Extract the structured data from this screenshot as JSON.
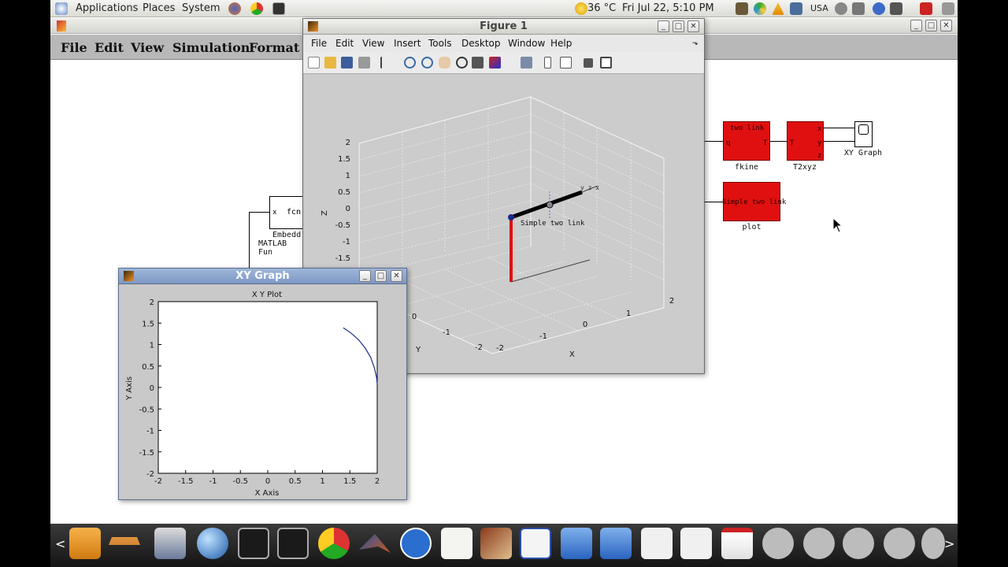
{
  "top_panel": {
    "menus": [
      "Applications",
      "Places",
      "System"
    ],
    "weather": "36 °C",
    "clock": "Fri Jul 22,  5:10 PM",
    "keyboard_layout": "USA"
  },
  "simulink": {
    "menus": [
      "File",
      "Edit",
      "View",
      "Simulation",
      "Format"
    ],
    "blocks": {
      "embedded_fcn": {
        "inner": "fcn",
        "port_in": "x",
        "label_line1": "Embedd",
        "label_line2": "MATLAB Fun"
      },
      "fkine": {
        "inner": "two link",
        "port_q": "q",
        "port_t": "T",
        "label": "fkine"
      },
      "t2xyz": {
        "port_t": "T",
        "port_x": "x",
        "port_y": "y",
        "port_z": "z",
        "label": "T2xyz"
      },
      "xy_graph": {
        "label": "XY Graph"
      },
      "plot": {
        "inner": "Simple two link",
        "label": "plot"
      }
    }
  },
  "figure1": {
    "title": "Figure 1",
    "menus": [
      "File",
      "Edit",
      "View",
      "Insert",
      "Tools",
      "Desktop",
      "Window",
      "Help"
    ],
    "menu_arrow": "⬎",
    "robot_label": "Simple two link",
    "arm_tip_labels": "y z x",
    "axis_labels": {
      "x": "X",
      "y": "Y",
      "z": "Z"
    },
    "z_ticks": [
      "2",
      "1.5",
      "1",
      "0.5",
      "0",
      "-0.5",
      "-1",
      "-1.5"
    ],
    "x_ticks": [
      "-2",
      "-1",
      "0",
      "1",
      "2"
    ],
    "y_ticks": [
      "-2",
      "-1",
      "0"
    ]
  },
  "xy_graph": {
    "title": "XY Graph",
    "chart_data": {
      "type": "line",
      "title": "X Y Plot",
      "xlabel": "X Axis",
      "ylabel": "Y Axis",
      "xlim": [
        -2,
        2
      ],
      "ylim": [
        -2,
        2
      ],
      "x_ticks": [
        "-2",
        "-1.5",
        "-1",
        "-0.5",
        "0",
        "0.5",
        "1",
        "1.5",
        "2"
      ],
      "y_ticks": [
        "2",
        "1.5",
        "1",
        "0.5",
        "0",
        "-0.5",
        "-1",
        "-1.5",
        "-2"
      ],
      "grid": false,
      "series": [
        {
          "x": [
            1.38,
            1.52,
            1.66,
            1.78,
            1.88,
            1.95,
            1.99,
            2.0
          ],
          "y": [
            1.39,
            1.27,
            1.11,
            0.92,
            0.7,
            0.45,
            0.22,
            0.08
          ]
        }
      ],
      "line_color": "#1a2e8a"
    }
  },
  "window_buttons": {
    "min": "_",
    "max": "□",
    "close": "✕"
  },
  "colors": {
    "block_red": "#e01010",
    "robot_link_red": "#dd1111",
    "robot_link_black": "#000000"
  }
}
